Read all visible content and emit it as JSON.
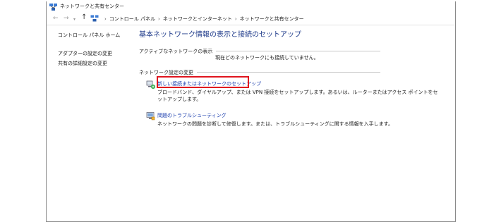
{
  "window": {
    "title": "ネットワークと共有センター"
  },
  "nav": {
    "back_glyph": "←",
    "forward_glyph": "→",
    "dropdown_glyph": "▾",
    "up_glyph": "↑"
  },
  "breadcrumb": {
    "items": [
      "コントロール パネル",
      "ネットワークとインターネット",
      "ネットワークと共有センター"
    ],
    "separator": "›"
  },
  "sidebar": {
    "home_label": "コントロール パネル ホーム",
    "items": [
      "アダプターの設定の変更",
      "共有の詳細設定の変更"
    ]
  },
  "main": {
    "heading": "基本ネットワーク情報の表示と接続のセットアップ",
    "active_networks": {
      "label": "アクティブなネットワークの表示",
      "status": "現在どのネットワークにも接続していません。"
    },
    "change_settings": {
      "label": "ネットワーク設定の変更",
      "tasks": [
        {
          "icon": "network-setup-icon",
          "link": "新しい接続またはネットワークのセットアップ",
          "description_line1": "ブロードバンド、ダイヤルアップ、または VPN 接続をセットアップします。あるいは、ルーターまたはアクセス ポイントをセ",
          "description_line2": "ットアップします。"
        },
        {
          "icon": "troubleshoot-icon",
          "link": "問題のトラブルシューティング",
          "description_line1": "ネットワークの問題を診断して修復します。または、トラブルシューティングに関する情報を入手します。"
        }
      ]
    }
  },
  "colors": {
    "link": "#1e40af",
    "heading": "#1e3a8a",
    "highlight": "#e0141e"
  }
}
